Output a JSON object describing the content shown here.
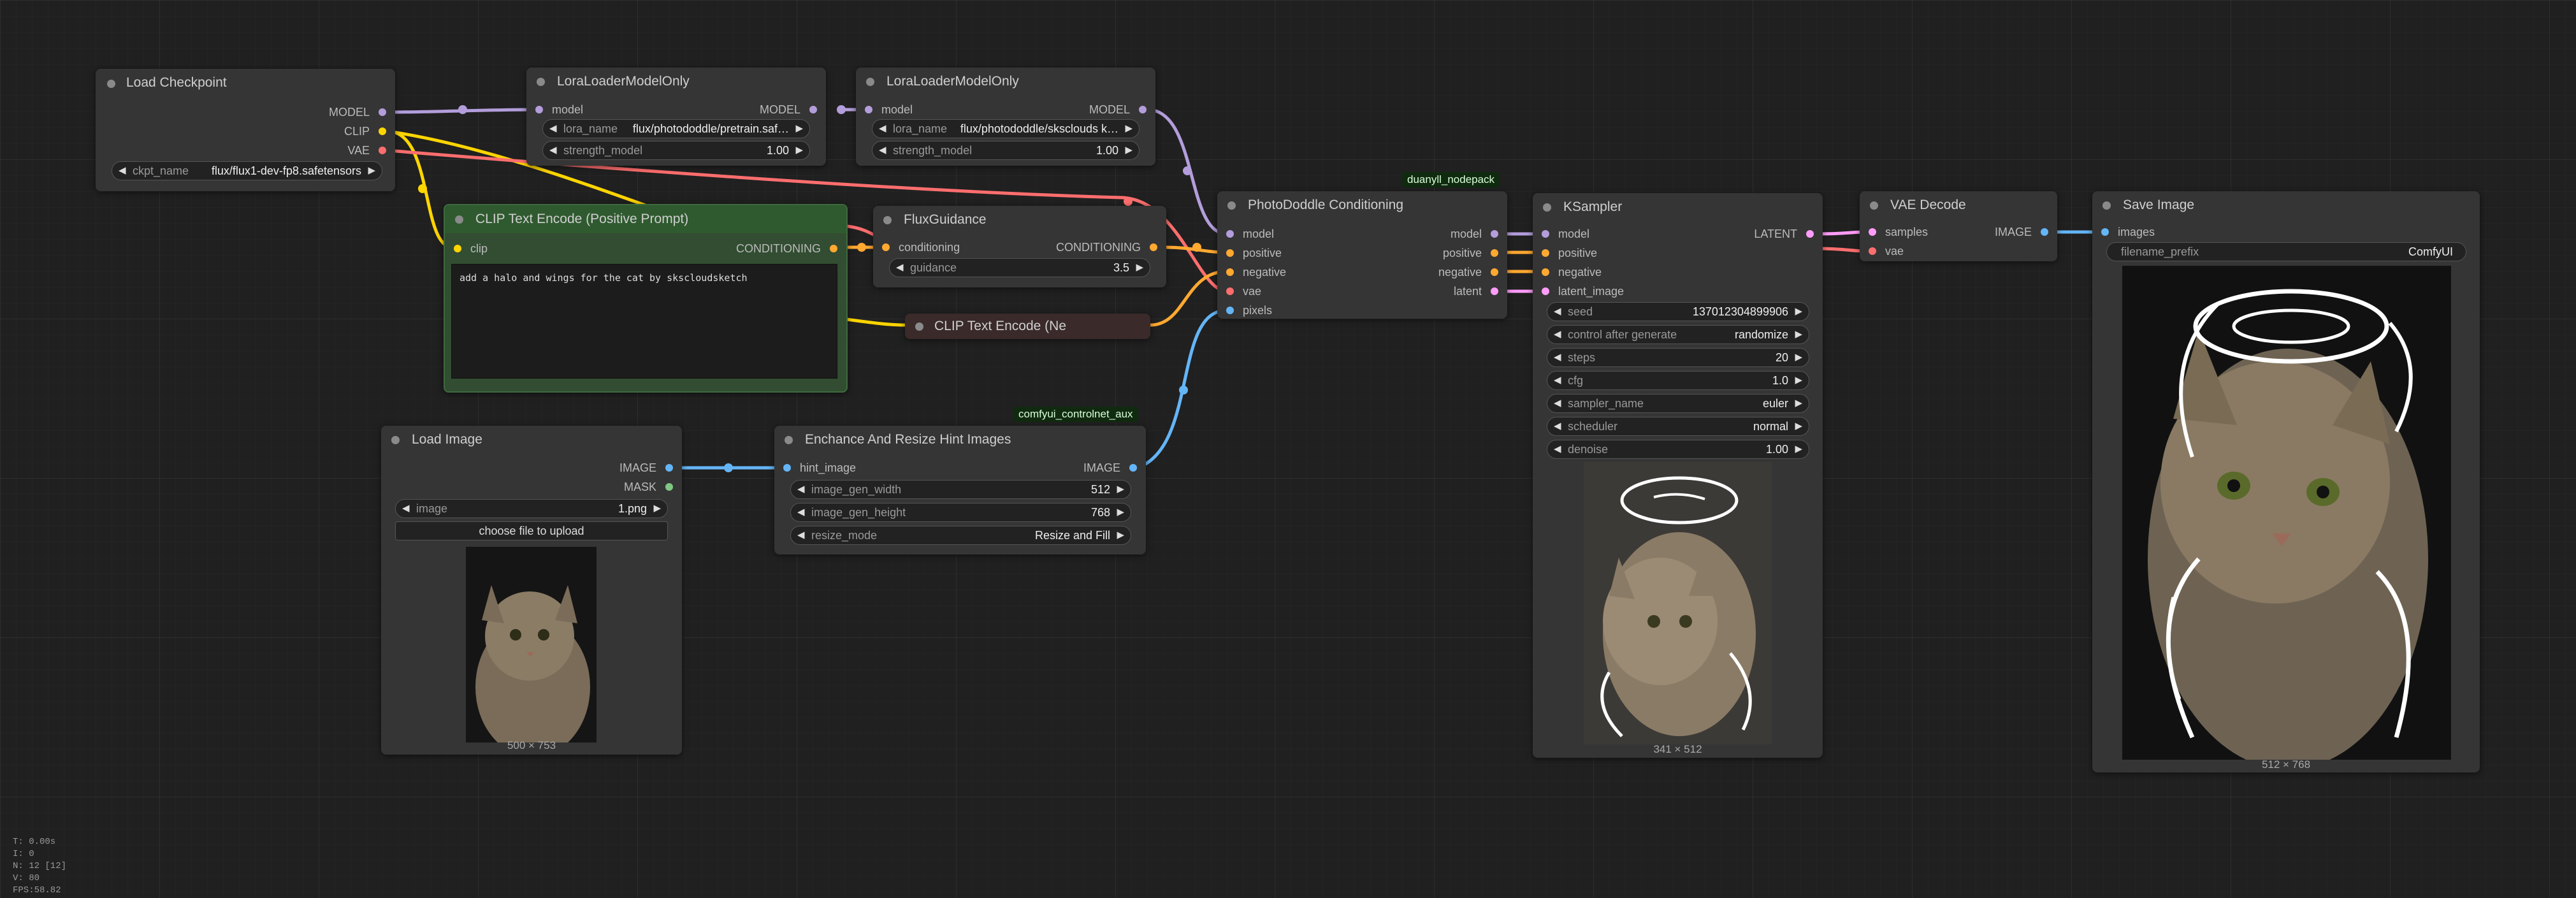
{
  "colors": {
    "model": "#b39ddb",
    "clip": "#ffd500",
    "vae": "#ff6e6e",
    "conditioning": "#ffa931",
    "image": "#64b5f6",
    "latent": "#ff9cf9",
    "mask": "#81c784"
  },
  "nodes": {
    "load_checkpoint": {
      "title": "Load Checkpoint",
      "outputs": [
        "MODEL",
        "CLIP",
        "VAE"
      ],
      "ckpt_label": "ckpt_name",
      "ckpt_value": "flux/flux1-dev-fp8.safetensors"
    },
    "lora1": {
      "title": "LoraLoaderModelOnly",
      "input": "model",
      "output": "MODEL",
      "lora_label": "lora_name",
      "lora_value": "flux/photododdle/pretrain.saf…",
      "strength_label": "strength_model",
      "strength_value": "1.00"
    },
    "lora2": {
      "title": "LoraLoaderModelOnly",
      "input": "model",
      "output": "MODEL",
      "lora_label": "lora_name",
      "lora_value": "flux/photododdle/sksclouds k…",
      "strength_label": "strength_model",
      "strength_value": "1.00"
    },
    "clip_pos": {
      "title": "CLIP Text Encode (Positive Prompt)",
      "input": "clip",
      "output": "CONDITIONING",
      "prompt": "add a halo and wings for the cat by sksclоudsketch"
    },
    "clip_neg": {
      "title": "CLIP Text Encode (Ne"
    },
    "flux_guidance": {
      "title": "FluxGuidance",
      "input": "conditioning",
      "output": "CONDITIONING",
      "guidance_label": "guidance",
      "guidance_value": "3.5"
    },
    "photododdle": {
      "title": "PhotoDoddle Conditioning",
      "badge": "duanyll_nodepack",
      "inputs": [
        "model",
        "positive",
        "negative",
        "vae",
        "pixels"
      ],
      "outputs": [
        "model",
        "positive",
        "negative",
        "latent"
      ]
    },
    "ksampler": {
      "title": "KSampler",
      "inputs": [
        "model",
        "positive",
        "negative",
        "latent_image"
      ],
      "output": "LATENT",
      "widgets": [
        {
          "label": "seed",
          "value": "137012304899906"
        },
        {
          "label": "control after generate",
          "value": "randomize"
        },
        {
          "label": "steps",
          "value": "20"
        },
        {
          "label": "cfg",
          "value": "1.0"
        },
        {
          "label": "sampler_name",
          "value": "euler"
        },
        {
          "label": "scheduler",
          "value": "normal"
        },
        {
          "label": "denoise",
          "value": "1.00"
        }
      ],
      "image_caption": "341 × 512"
    },
    "vae_decode": {
      "title": "VAE Decode",
      "inputs": [
        "samples",
        "vae"
      ],
      "output": "IMAGE"
    },
    "save_image": {
      "title": "Save Image",
      "input": "images",
      "prefix_label": "filename_prefix",
      "prefix_value": "ComfyUI",
      "image_caption": "512 × 768"
    },
    "load_image": {
      "title": "Load Image",
      "outputs": [
        "IMAGE",
        "MASK"
      ],
      "image_label": "image",
      "image_value": "1.png",
      "upload_label": "choose file to upload",
      "image_caption": "500 × 753"
    },
    "enhance": {
      "title": "Enchance And Resize Hint Images",
      "badge": "comfyui_controlnet_aux",
      "input": "hint_image",
      "output": "IMAGE",
      "widgets": [
        {
          "label": "image_gen_width",
          "value": "512"
        },
        {
          "label": "image_gen_height",
          "value": "768"
        },
        {
          "label": "resize_mode",
          "value": "Resize and Fill"
        }
      ]
    }
  },
  "stats": [
    "T: 0.00s",
    "I: 0",
    "N: 12 [12]",
    "V: 80",
    "FPS:58.82"
  ]
}
